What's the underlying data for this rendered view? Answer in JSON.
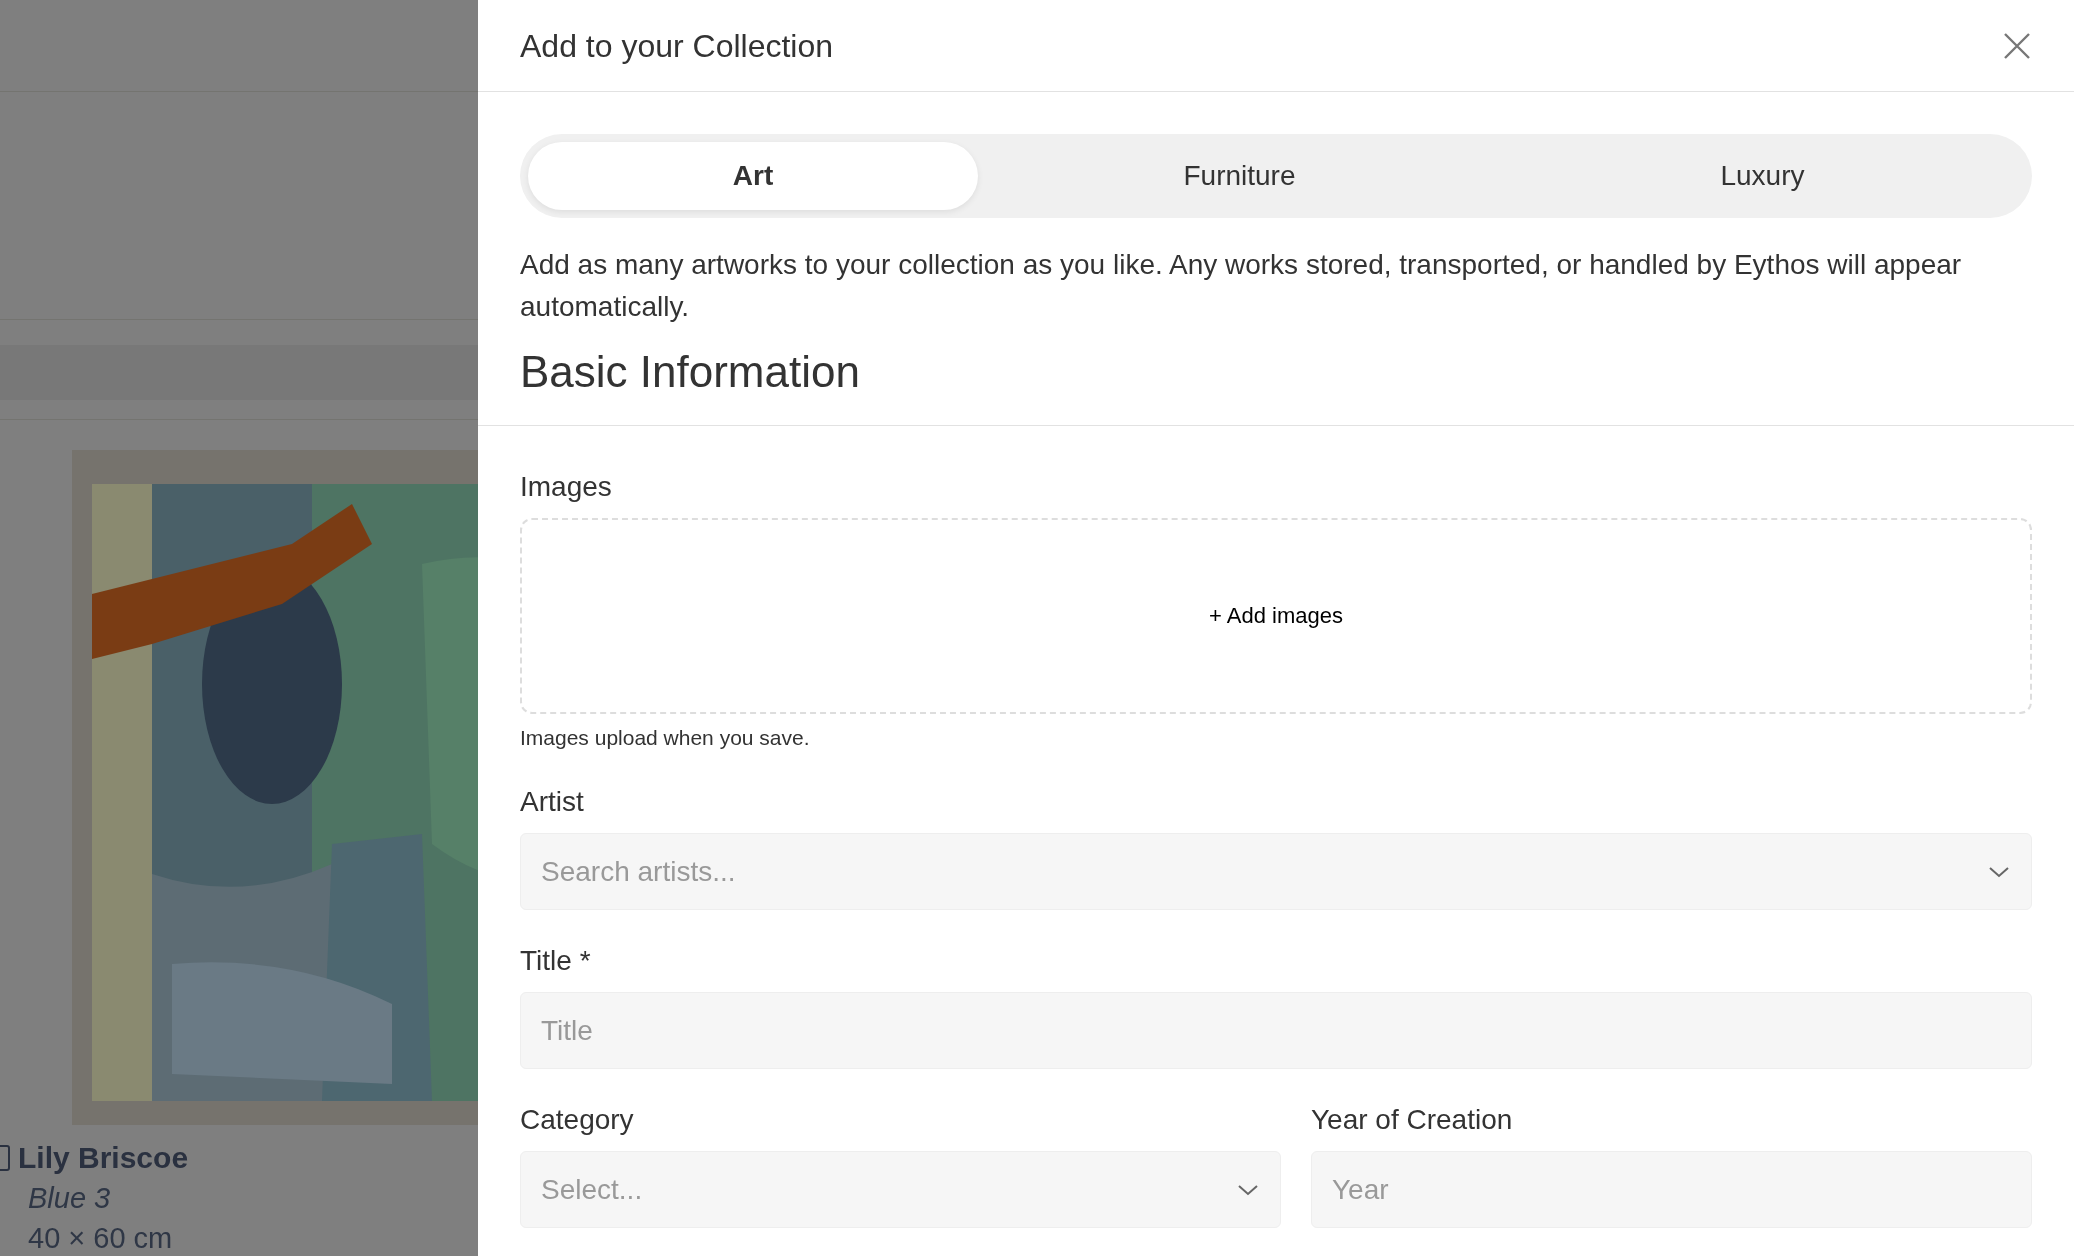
{
  "backdrop": {
    "item": {
      "checked": false,
      "artist": "Lily Briscoe",
      "title": "Blue 3",
      "dimensions": "40 × 60 cm"
    }
  },
  "drawer": {
    "title": "Add to your Collection",
    "tabs": [
      {
        "label": "Art",
        "selected": true
      },
      {
        "label": "Furniture",
        "selected": false
      },
      {
        "label": "Luxury",
        "selected": false
      }
    ],
    "description": "Add as many artworks to your collection as you like. Any works stored, transported, or handled by Eythos will appear automatically.",
    "section_title": "Basic Information",
    "rows": [
      [
        {
          "kind": "upload",
          "label": "Images",
          "action": "+ Add images",
          "hint": "Images upload when you save."
        }
      ],
      [
        {
          "kind": "select",
          "label": "Artist",
          "placeholder": "Search artists..."
        }
      ],
      [
        {
          "kind": "text",
          "label": "Title *",
          "placeholder": "Title"
        }
      ],
      [
        {
          "kind": "select",
          "label": "Category",
          "placeholder": "Select..."
        },
        {
          "kind": "text",
          "label": "Year of Creation",
          "placeholder": "Year"
        }
      ]
    ]
  }
}
